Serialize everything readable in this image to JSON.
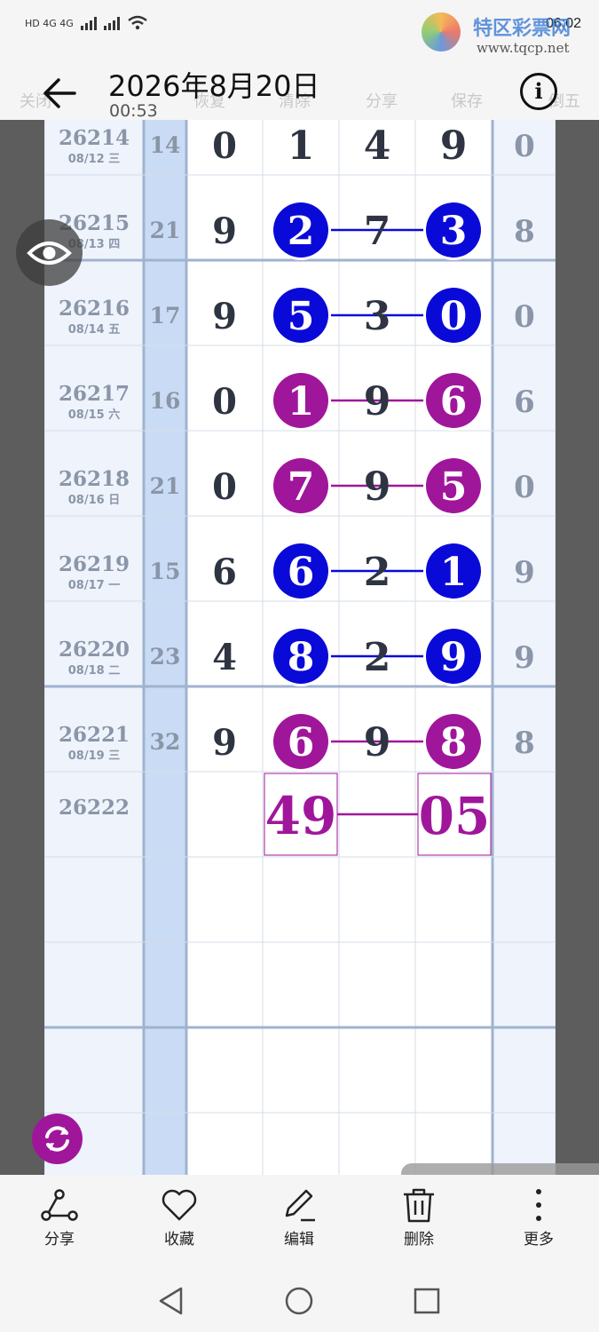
{
  "status_bar": {
    "left": "HD 4G 4G",
    "right": "06:02"
  },
  "watermark": {
    "brand": "特区彩票网",
    "url": "www.tqcp.net"
  },
  "header": {
    "title": "2026年8月20日",
    "subtitle": "00:53",
    "ghost_labels": [
      "关闭",
      "恢复",
      "清除",
      "分享",
      "保存",
      "倒五"
    ]
  },
  "colors": {
    "blue": "#0a0ad8",
    "purple": "#a0169b",
    "grid": "#aebfd8",
    "header_col": "#cadcf5",
    "row_bg": "#eef3fc"
  },
  "table": {
    "rows": [
      {
        "issue": "26214",
        "date": "08/12 三",
        "sum": "14",
        "digit": "0",
        "nums": [
          "1",
          "4",
          "9"
        ],
        "tail": "0",
        "color": "none",
        "partial": true
      },
      {
        "issue": "26215",
        "date": "08/13 四",
        "sum": "21",
        "digit": "9",
        "nums": [
          "2",
          "7",
          "3"
        ],
        "tail": "8",
        "color": "blue"
      },
      {
        "issue": "26216",
        "date": "08/14 五",
        "sum": "17",
        "digit": "9",
        "nums": [
          "5",
          "3",
          "0"
        ],
        "tail": "0",
        "color": "blue"
      },
      {
        "issue": "26217",
        "date": "08/15 六",
        "sum": "16",
        "digit": "0",
        "nums": [
          "1",
          "9",
          "6"
        ],
        "tail": "6",
        "color": "purple"
      },
      {
        "issue": "26218",
        "date": "08/16 日",
        "sum": "21",
        "digit": "0",
        "nums": [
          "7",
          "9",
          "5"
        ],
        "tail": "0",
        "color": "purple"
      },
      {
        "issue": "26219",
        "date": "08/17 一",
        "sum": "15",
        "digit": "6",
        "nums": [
          "6",
          "2",
          "1"
        ],
        "tail": "9",
        "color": "blue"
      },
      {
        "issue": "26220",
        "date": "08/18 二",
        "sum": "23",
        "digit": "4",
        "nums": [
          "8",
          "2",
          "9"
        ],
        "tail": "9",
        "color": "blue"
      },
      {
        "issue": "26221",
        "date": "08/19 三",
        "sum": "32",
        "digit": "9",
        "nums": [
          "6",
          "9",
          "8"
        ],
        "tail": "8",
        "color": "purple"
      }
    ],
    "forecast": {
      "issue": "26222",
      "left": "49",
      "right": "05"
    }
  },
  "toolbar": {
    "items": [
      {
        "label": "分享",
        "icon": "share-icon"
      },
      {
        "label": "收藏",
        "icon": "heart-icon"
      },
      {
        "label": "编辑",
        "icon": "pencil-icon"
      },
      {
        "label": "删除",
        "icon": "trash-icon"
      },
      {
        "label": "更多",
        "icon": "more-icon"
      }
    ]
  },
  "nav": {
    "items": [
      "back-triangle-icon",
      "home-circle-icon",
      "recents-square-icon"
    ]
  }
}
